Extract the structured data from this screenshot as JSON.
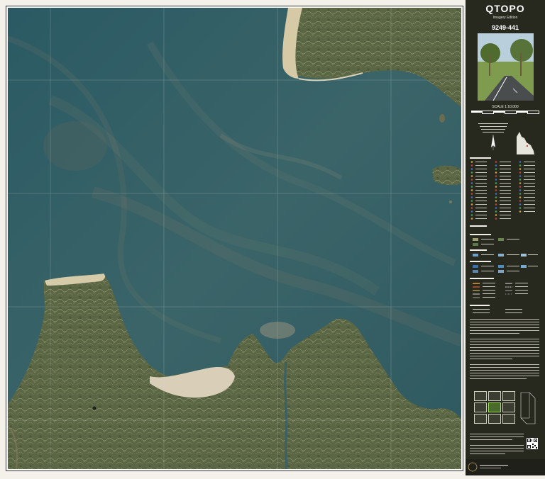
{
  "map": {
    "brand": "QTOPO",
    "edition": "Imagery Edition",
    "sheet_number": "9249-441",
    "scale": "SCALE 1:10,000"
  },
  "colors": {
    "panel_bg": "#27291f",
    "water": "#2f5b63",
    "land": "#5f6a45",
    "sand": "#d8cdb2"
  },
  "icons": [
    "qld-outline-icon",
    "qr-code-icon",
    "north-arrow-icon"
  ]
}
